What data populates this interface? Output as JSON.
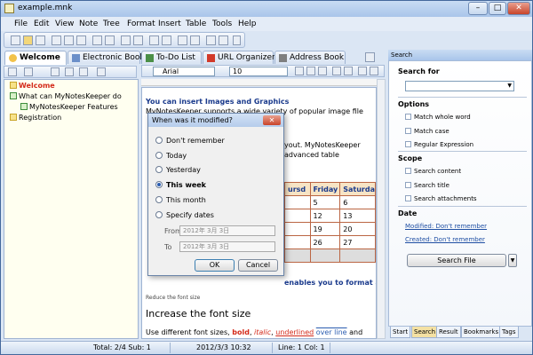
{
  "window": {
    "title": "example.mnk",
    "min": "–",
    "max": "□",
    "close": "✕"
  },
  "menu": [
    "File",
    "Edit",
    "View",
    "Note",
    "Tree",
    "Format",
    "Insert",
    "Table",
    "Tools",
    "Help"
  ],
  "tabs": [
    {
      "label": "Welcome",
      "active": true
    },
    {
      "label": "Electronic Book"
    },
    {
      "label": "To-Do List"
    },
    {
      "label": "URL Organizer"
    },
    {
      "label": "Address Book"
    }
  ],
  "tree": {
    "nodes": [
      {
        "label": "Welcome",
        "level": 0,
        "highlight": true
      },
      {
        "label": "What can MyNotesKeeper do",
        "level": 0
      },
      {
        "label": "MyNotesKeeper Features",
        "level": 1
      },
      {
        "label": "Registration",
        "level": 0
      }
    ]
  },
  "format": {
    "font": "Arial",
    "size": "10"
  },
  "editor": {
    "heading": "You can insert Images and Graphics",
    "line1": "MyNotesKeeper supports a wide variety of popular image file",
    "line2": "yout. MyNotesKeeper",
    "line3": "advanced table",
    "table_headers": [
      "ursd",
      "Friday",
      "Saturda"
    ],
    "table_rows": [
      [
        "",
        "5",
        "6"
      ],
      [
        "",
        "12",
        "13"
      ],
      [
        "",
        "19",
        "20"
      ],
      [
        "",
        "26",
        "27"
      ],
      [
        "",
        "",
        ""
      ]
    ],
    "line4": "enables you to format all your text",
    "line5": "Reduce the font size",
    "big": "Increase the font size",
    "line6_a": "Use different font sizes,",
    "line6_bold": "bold",
    "line6_italic": "italic",
    "line6_under": "underlined",
    "line6_over": "over line",
    "line6_and": "and"
  },
  "dialog": {
    "title": "When was it modified?",
    "close": "✕",
    "options": [
      {
        "label": "Don't remember",
        "checked": false
      },
      {
        "label": "Today",
        "checked": false
      },
      {
        "label": "Yesterday",
        "checked": false
      },
      {
        "label": "This week",
        "checked": true
      },
      {
        "label": "This month",
        "checked": false
      },
      {
        "label": "Specify dates",
        "checked": false
      }
    ],
    "from_label": "From",
    "to_label": "To",
    "from_value": "2012年 3月 3日",
    "to_value": "2012年 3月 3日",
    "ok": "OK",
    "cancel": "Cancel"
  },
  "search": {
    "panel_title": "Search",
    "search_for": "Search for",
    "options_title": "Options",
    "options": [
      "Match whole word",
      "Match case",
      "Regular Expression"
    ],
    "scope_title": "Scope",
    "scope": [
      "Search content",
      "Search title",
      "Search attachments"
    ],
    "date_title": "Date",
    "modified": "Modified: Don't remember",
    "created": "Created: Don't remember",
    "button": "Search File",
    "bottom_tabs": [
      "Start",
      "Search",
      "Result",
      "Bookmarks",
      "Tags"
    ]
  },
  "status": {
    "total": "Total: 2/4  Sub: 1",
    "datetime": "2012/3/3 10:32",
    "linecol": "Line: 1  Col: 1"
  }
}
